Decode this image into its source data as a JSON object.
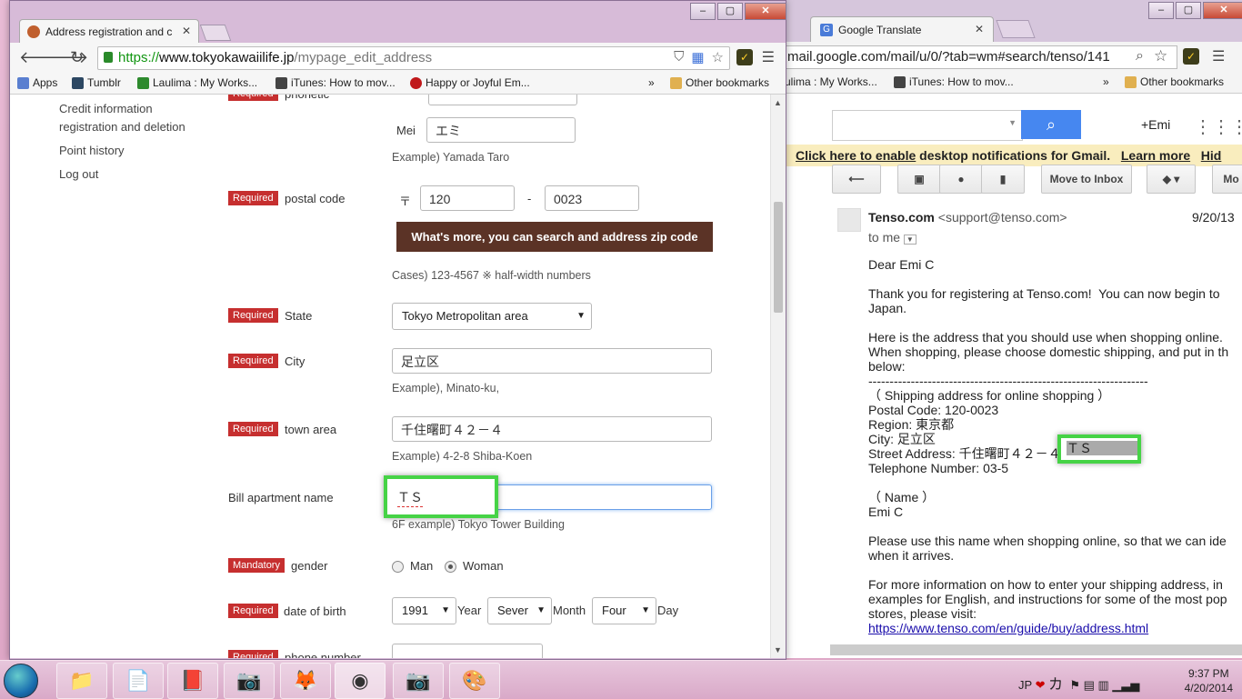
{
  "front_window": {
    "tab_title": "Address registration and c",
    "url_https": "https://",
    "url_host": "www.tokyokawaiilife.jp",
    "url_path": "/mypage_edit_address",
    "bookmarks": [
      "Apps",
      "Tumblr",
      "Laulima : My Works...",
      "iTunes: How to mov...",
      "Happy or Joyful Em..."
    ],
    "bookmarks_more": "»",
    "other_bookmarks": "Other bookmarks",
    "sidebar": [
      "Credit information",
      "registration and deletion",
      "Point history",
      "Log out"
    ],
    "form": {
      "required_badge": "Required",
      "mandatory_badge": "Mandatory",
      "phonetic_label": "phonetic",
      "mei_label": "Mei",
      "mei_value": "エミ",
      "name_example": "Example) Yamada Taro",
      "postal_label": "postal code",
      "postal_mark": "〒",
      "postal_1": "120",
      "postal_dash": "-",
      "postal_2": "0023",
      "zip_button": "What's more, you can search and address zip code",
      "postal_hint": "Cases) 123-4567 ※ half-width numbers",
      "state_label": "State",
      "state_value": "Tokyo Metropolitan area",
      "city_label": "City",
      "city_value": "足立区",
      "city_hint": "Example), Minato-ku,",
      "town_label": "town area",
      "town_value": "千住曙町４２－４",
      "town_hint": "Example) 4-2-8 Shiba-Koen",
      "apt_label": "Bill apartment name",
      "apt_value": "ＴＳ",
      "apt_hint": "6F example) Tokyo Tower Building",
      "gender_label": "gender",
      "gender_man": "Man",
      "gender_woman": "Woman",
      "dob_label": "date of birth",
      "dob_year": "1991",
      "dob_year_unit": "Year",
      "dob_month": "Sever",
      "dob_month_unit": "Month",
      "dob_day": "Four",
      "dob_day_unit": "Day",
      "phone_label": "phone number"
    }
  },
  "back_window": {
    "tab_title": "Google Translate",
    "url": "mail.google.com/mail/u/0/?tab=wm#search/tenso/141",
    "bookmarks": [
      "ulima : My Works...",
      "iTunes: How to mov..."
    ],
    "bookmarks_more": "»",
    "other_bookmarks": "Other bookmarks",
    "account": "+Emi",
    "banner_link": "Click here to enable",
    "banner_text": " desktop notifications for Gmail.",
    "banner_learn": "Learn more",
    "banner_hide": "Hid",
    "move_inbox": "Move to Inbox",
    "more_btn": "Mo",
    "sender": "Tenso.com",
    "sender_email": "<support@tenso.com>",
    "date": "9/20/13",
    "to_me": "to me",
    "body": [
      "Dear Emi C",
      "",
      "Thank you for registering at Tenso.com!  You can now begin to",
      "Japan.",
      "",
      "Here is the address that you should use when shopping online.",
      "When shopping, please choose domestic shipping, and put in th",
      "below:",
      "------------------------------------------------------------------",
      "（ Shipping address for online shopping ）",
      "Postal Code: 120-0023",
      "Region: 東京都",
      "City: 足立区",
      "Street Address: 千住曙町４２－４",
      "Telephone Number: 03-5",
      "",
      "（ Name ）",
      "Emi C",
      "",
      "Please use this name when shopping online, so that we can ide",
      "when it arrives.",
      "",
      "For more information on how to enter your shipping address, in",
      "examples for English, and instructions for some of the most pop",
      "stores, please visit:"
    ],
    "street_highlight": "ＴＳ",
    "link": "https://www.tenso.com/en/guide/buy/address.html"
  },
  "taskbar": {
    "lang": "JP",
    "ime": "カ",
    "time": "9:37 PM",
    "date": "4/20/2014"
  }
}
